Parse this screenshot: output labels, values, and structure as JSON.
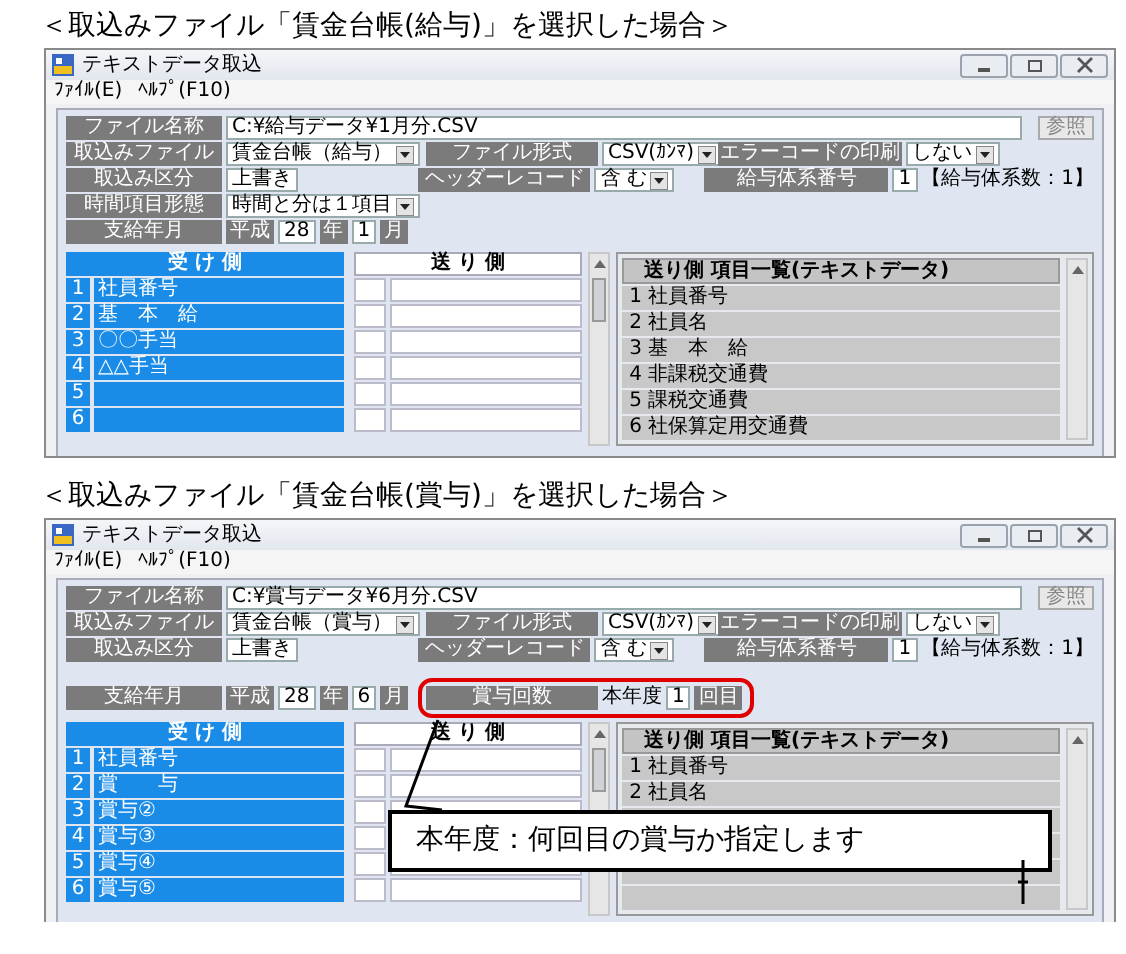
{
  "sections": [
    {
      "heading": "＜取込みファイル「賃金台帳(給与)」を選択した場合＞",
      "window": {
        "title": "テキストデータ取込",
        "menu": [
          "ﾌｧｲﾙ(E)",
          "ﾍﾙﾌﾟ(F10)"
        ],
        "form": [
          {
            "groups": [
              {
                "label": "ファイル名称",
                "highlighted": false,
                "values": [
                  {
                    "kind": "path",
                    "text": "C:¥給与データ¥1月分.CSV"
                  },
                  {
                    "kind": "button",
                    "text": "参照"
                  }
                ]
              }
            ]
          },
          {
            "groups": [
              {
                "label": "取込みファイル",
                "highlighted": false,
                "values": [
                  {
                    "kind": "combo",
                    "text": "賃金台帳（給与）"
                  }
                ]
              },
              {
                "label": "ファイル形式",
                "highlighted": false,
                "values": [
                  {
                    "kind": "combo",
                    "text": "CSV(ｶﾝﾏ)"
                  }
                ]
              },
              {
                "label": "エラーコードの印刷",
                "highlighted": false,
                "values": [
                  {
                    "kind": "combo",
                    "text": "しない"
                  }
                ]
              }
            ]
          },
          {
            "groups": [
              {
                "label": "取込み区分",
                "highlighted": false,
                "values": [
                  {
                    "kind": "field",
                    "text": "上書き"
                  }
                ]
              },
              {
                "label": "ヘッダーレコード",
                "highlighted": false,
                "values": [
                  {
                    "kind": "combo",
                    "text": "含 む"
                  }
                ]
              },
              {
                "label": "給与体系番号",
                "highlighted": false,
                "values": [
                  {
                    "kind": "field",
                    "text": "1"
                  },
                  {
                    "kind": "text",
                    "text": "【給与体系数：1】"
                  }
                ]
              }
            ]
          },
          {
            "groups": [
              {
                "label": "時間項目形態",
                "highlighted": false,
                "values": [
                  {
                    "kind": "combo",
                    "text": "時間と分は１項目"
                  }
                ]
              }
            ]
          },
          {
            "groups": [
              {
                "label": "支給年月",
                "highlighted": false,
                "values": [
                  {
                    "kind": "unit",
                    "text": "平成"
                  },
                  {
                    "kind": "field",
                    "text": "28"
                  },
                  {
                    "kind": "unit",
                    "text": "年"
                  },
                  {
                    "kind": "field",
                    "text": "1"
                  },
                  {
                    "kind": "unit",
                    "text": "月"
                  }
                ]
              }
            ]
          }
        ],
        "receive_table": {
          "header": "受 け 側",
          "send_header": "送 り 側",
          "rows": [
            {
              "number": "1",
              "name": "社員番号"
            },
            {
              "number": "2",
              "name": "基　本　給"
            },
            {
              "number": "3",
              "name": "〇〇手当"
            },
            {
              "number": "4",
              "name": "△△手当"
            },
            {
              "number": "5"
            },
            {
              "number": "6"
            }
          ]
        },
        "send_list": {
          "header": "送り側 項目一覧(テキストデータ)",
          "rows": [
            {
              "number": "1",
              "name": "社員番号"
            },
            {
              "number": "2",
              "name": "社員名"
            },
            {
              "number": "3",
              "name": "基　本　給"
            },
            {
              "number": "4",
              "name": "非課税交通費"
            },
            {
              "number": "5",
              "name": "課税交通費"
            },
            {
              "number": "6",
              "name": "社保算定用交通費"
            }
          ]
        }
      }
    },
    {
      "heading": "＜取込みファイル「賃金台帳(賞与)」を選択した場合＞",
      "window": {
        "title": "テキストデータ取込",
        "menu": [
          "ﾌｧｲﾙ(E)",
          "ﾍﾙﾌﾟ(F10)"
        ],
        "form": [
          {
            "groups": [
              {
                "label": "ファイル名称",
                "highlighted": false,
                "values": [
                  {
                    "kind": "path",
                    "text": "C:¥賞与データ¥6月分.CSV"
                  },
                  {
                    "kind": "button",
                    "text": "参照"
                  }
                ]
              }
            ]
          },
          {
            "groups": [
              {
                "label": "取込みファイル",
                "highlighted": false,
                "values": [
                  {
                    "kind": "combo",
                    "text": "賃金台帳（賞与）"
                  }
                ]
              },
              {
                "label": "ファイル形式",
                "highlighted": false,
                "values": [
                  {
                    "kind": "combo",
                    "text": "CSV(ｶﾝﾏ)"
                  }
                ]
              },
              {
                "label": "エラーコードの印刷",
                "highlighted": false,
                "values": [
                  {
                    "kind": "combo",
                    "text": "しない"
                  }
                ]
              }
            ]
          },
          {
            "groups": [
              {
                "label": "取込み区分",
                "highlighted": false,
                "values": [
                  {
                    "kind": "field",
                    "text": "上書き"
                  }
                ]
              },
              {
                "label": "ヘッダーレコード",
                "highlighted": false,
                "values": [
                  {
                    "kind": "combo",
                    "text": "含 む"
                  }
                ]
              },
              {
                "label": "給与体系番号",
                "highlighted": false,
                "values": [
                  {
                    "kind": "field",
                    "text": "1"
                  },
                  {
                    "kind": "text",
                    "text": "【給与体系数：1】"
                  }
                ]
              }
            ]
          },
          {
            "groups": [
              {
                "label": "支給年月",
                "highlighted": false,
                "values": [
                  {
                    "kind": "unit",
                    "text": "平成"
                  },
                  {
                    "kind": "field",
                    "text": "28"
                  },
                  {
                    "kind": "unit",
                    "text": "年"
                  },
                  {
                    "kind": "field",
                    "text": "6"
                  },
                  {
                    "kind": "unit",
                    "text": "月"
                  }
                ]
              },
              {
                "label": "賞与回数",
                "highlighted": true,
                "values": [
                  {
                    "kind": "text",
                    "text": "本年度"
                  },
                  {
                    "kind": "field",
                    "text": "1"
                  },
                  {
                    "kind": "unit",
                    "text": "回目"
                  }
                ]
              }
            ]
          }
        ],
        "receive_table": {
          "header": "受 け 側",
          "send_header": "送 り 側",
          "rows": [
            {
              "number": "1",
              "name": "社員番号"
            },
            {
              "number": "2",
              "name": "賞　　与"
            },
            {
              "number": "3",
              "name": "賞与②"
            },
            {
              "number": "4",
              "name": "賞与③"
            },
            {
              "number": "5",
              "name": "賞与④"
            },
            {
              "number": "6",
              "name": "賞与⑤"
            }
          ]
        },
        "send_list": {
          "header": "送り側 項目一覧(テキストデータ)",
          "rows": [
            {
              "number": "1",
              "name": "社員番号"
            },
            {
              "number": "2",
              "name": "社員名"
            }
          ]
        },
        "callout": {
          "text": "本年度：何回目の賞与か指定します"
        }
      }
    }
  ]
}
